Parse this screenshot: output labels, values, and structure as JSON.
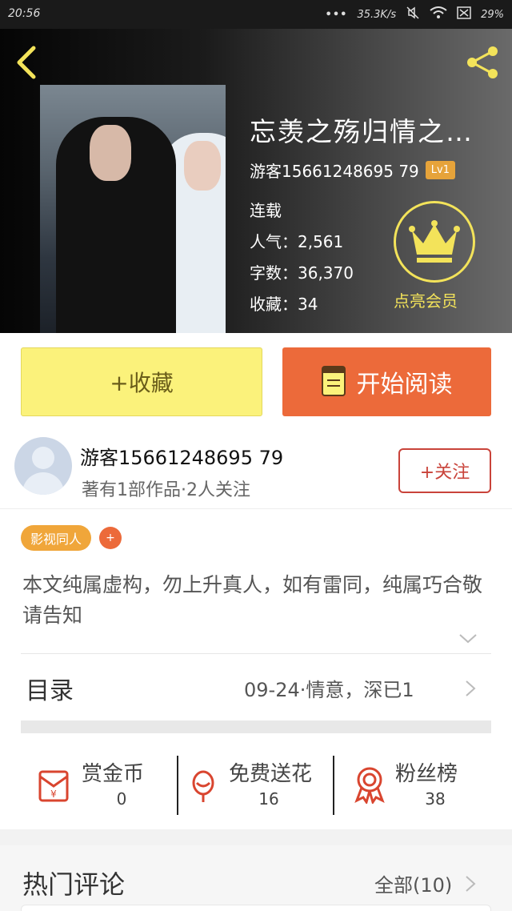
{
  "status_bar": {
    "time": "20:56",
    "dots": "•••",
    "network_speed": "35.3K/s",
    "battery": "29%"
  },
  "header": {
    "title": "忘羡之殇归情之…",
    "author": "游客15661248695 79",
    "level": "Lv1",
    "status": "连载",
    "popularity": "人气：2,561",
    "word_count": "字数：36,370",
    "favorites": "收藏：34",
    "member_label": "点亮会员"
  },
  "actions": {
    "favorite_label": "+收藏",
    "read_label": "开始阅读"
  },
  "author_card": {
    "name": "游客15661248695 79",
    "subtitle": "著有1部作品·2人关注",
    "follow_label": "+关注"
  },
  "tags": {
    "items": [
      "影视同人"
    ],
    "add_label": "+"
  },
  "description": "本文纯属虚构，勿上升真人，如有雷同，纯属巧合敬请告知",
  "catalog": {
    "label": "目录",
    "latest": "09-24·情意，深已1"
  },
  "stats": {
    "reward": {
      "label": "赏金币",
      "value": "0"
    },
    "flowers": {
      "label": "免费送花",
      "value": "16"
    },
    "fans": {
      "label": "粉丝榜",
      "value": "38"
    }
  },
  "comments": {
    "label": "热门评论",
    "all_label": "全部(10)"
  },
  "colors": {
    "favorite_bg": "#fbf27b",
    "read_bg": "#ec6a3a",
    "tag_bg": "#f0a63a",
    "follow": "#c9433a",
    "crown": "#f3e35a"
  }
}
